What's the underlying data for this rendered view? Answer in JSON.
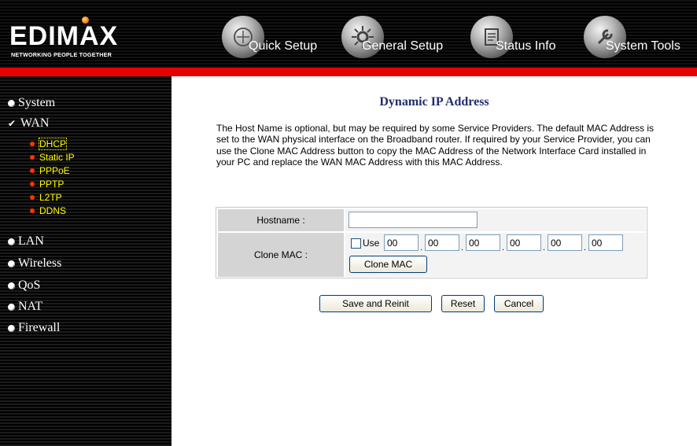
{
  "brand": {
    "logo_text": "EDIMAX",
    "tagline": "NETWORKING PEOPLE TOGETHER"
  },
  "topnav": [
    {
      "label": "Quick Setup",
      "icon": "quick-setup-icon"
    },
    {
      "label": "General Setup",
      "icon": "general-setup-icon"
    },
    {
      "label": "Status Info",
      "icon": "status-info-icon"
    },
    {
      "label": "System Tools",
      "icon": "system-tools-icon"
    }
  ],
  "sidebar": {
    "items": [
      {
        "label": "System"
      },
      {
        "label": "WAN",
        "expanded": true
      },
      {
        "label": "LAN"
      },
      {
        "label": "Wireless"
      },
      {
        "label": "QoS"
      },
      {
        "label": "NAT"
      },
      {
        "label": "Firewall"
      }
    ],
    "wan_subitems": [
      {
        "label": "DHCP",
        "active": true
      },
      {
        "label": "Static IP"
      },
      {
        "label": "PPPoE"
      },
      {
        "label": "PPTP"
      },
      {
        "label": "L2TP"
      },
      {
        "label": "DDNS"
      }
    ]
  },
  "main": {
    "title": "Dynamic IP Address",
    "description": "The Host Name is optional, but may be required by some Service Providers. The default MAC Address is set to the WAN physical interface on the Broadband router. If required by your Service Provider, you can use the Clone MAC Address button to copy the MAC Address of the Network Interface Card installed in your PC and replace the WAN MAC Address with this MAC Address.",
    "form": {
      "hostname_label": "Hostname :",
      "hostname_value": "",
      "clone_mac_label": "Clone MAC :",
      "use_label": "Use",
      "use_checked": false,
      "mac_octets": [
        "00",
        "00",
        "00",
        "00",
        "00",
        "00"
      ],
      "clone_mac_button": "Clone MAC"
    },
    "buttons": {
      "save": "Save and Reinit",
      "reset": "Reset",
      "cancel": "Cancel"
    }
  },
  "colors": {
    "accent_red": "#e60000",
    "title_blue": "#1f2e6b",
    "submenu_yellow": "#ffff00",
    "label_cell_gray": "#d4d4d4"
  }
}
